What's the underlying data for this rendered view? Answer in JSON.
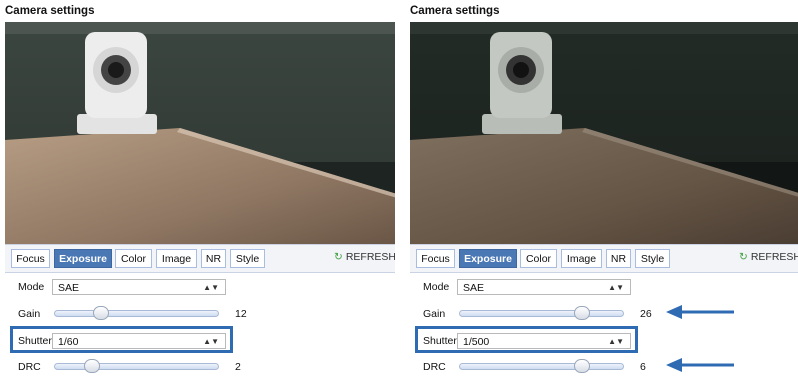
{
  "panels": [
    {
      "title": "Camera settings",
      "tabs": [
        "Focus",
        "Exposure",
        "Color",
        "Image",
        "NR",
        "Style"
      ],
      "active_tab": "Exposure",
      "refresh_label": "REFRESH",
      "mode": {
        "label": "Mode",
        "value": "SAE"
      },
      "gain": {
        "label": "Gain",
        "value": "12",
        "fraction": 0.28
      },
      "shutter": {
        "label": "Shutter",
        "value": "1/60"
      },
      "drc": {
        "label": "DRC",
        "value": "2",
        "fraction": 0.23
      }
    },
    {
      "title": "Camera settings",
      "tabs": [
        "Focus",
        "Exposure",
        "Color",
        "Image",
        "NR",
        "Style"
      ],
      "active_tab": "Exposure",
      "refresh_label": "REFRESH",
      "mode": {
        "label": "Mode",
        "value": "SAE"
      },
      "gain": {
        "label": "Gain",
        "value": "26",
        "fraction": 0.75
      },
      "shutter": {
        "label": "Shutter",
        "value": "1/500"
      },
      "drc": {
        "label": "DRC",
        "value": "6",
        "fraction": 0.75
      }
    }
  ],
  "colors": {
    "accent": "#4a78b5",
    "highlight": "#2f6bb3",
    "refresh_icon": "#46a245"
  }
}
